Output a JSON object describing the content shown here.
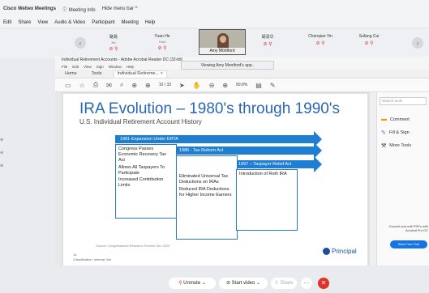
{
  "webex": {
    "title": "Cisco Webex Meetings",
    "meeting_info": "Meeting Info",
    "hide_menu_bar": "Hide menu bar ^",
    "menu": [
      "Edit",
      "Share",
      "View",
      "Audio & Video",
      "Participant",
      "Meeting",
      "Help"
    ],
    "participants": [
      {
        "name": "路易",
        "sub": "Nb"
      },
      {
        "name": "Yuan He",
        "sub": "Host"
      },
      {
        "name": "Amy Montford",
        "sub": ""
      },
      {
        "name": "胡清华",
        "sub": ""
      },
      {
        "name": "Chenqiao Yin",
        "sub": ""
      },
      {
        "name": "Sufang Cui",
        "sub": ""
      }
    ],
    "viewing_banner": "Viewing Amy Montford's app..",
    "controls": {
      "unmute": "Unmute",
      "start_video": "Start video",
      "share": "Share"
    }
  },
  "acrobat": {
    "title": "Individual Retirement Accounts - Adobe Acrobat Reader DC (32-bit)",
    "menu": [
      "File",
      "Edit",
      "View",
      "Sign",
      "Window",
      "Help"
    ],
    "tabs": [
      "Home",
      "Tools",
      "Individual Retireme... ×"
    ],
    "page_indicator": "10 / 33",
    "zoom": "89.8%",
    "side_panel": {
      "search_placeholder": "Search tools",
      "items": [
        "Comment",
        "Fill & Sign",
        "More Tools"
      ],
      "convert_text": "Convert and edit PDFs with Acrobat Pro DC",
      "free_trial": "Start Free Trial"
    }
  },
  "slide": {
    "title": "IRA Evolution – 1980's through 1990's",
    "subtitle": "U.S. Individual Retirement Account History",
    "arrows": [
      "1981-Expansion Under ERTA",
      "1986 - Tax Reform Act",
      "1997 – Taxpayer Relief Act"
    ],
    "box1": [
      "Congress Passes Economic Recovery Tax Act",
      "Allows All Taxpayers To Participate",
      "Increased Contribution Limits"
    ],
    "box2": [
      "Eliminated Universal Tax Deductions on IRAs",
      "Reduced IRA Deductions for Higher Income Earners"
    ],
    "box3": [
      "Introduction of Roth IRA"
    ],
    "source": "Source: Congressional Research Service Dec 2020",
    "page_number": "16",
    "classification": "Classification: Internal Use",
    "brand": "Principal"
  }
}
